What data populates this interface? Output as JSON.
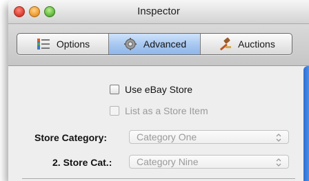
{
  "window": {
    "title": "Inspector"
  },
  "tabs": [
    {
      "label": "Options",
      "icon": "options-list-icon",
      "active": false
    },
    {
      "label": "Advanced",
      "icon": "gear-icon",
      "active": true
    },
    {
      "label": "Auctions",
      "icon": "gavel-icon",
      "active": false
    }
  ],
  "form": {
    "use_ebay_store": {
      "label": "Use eBay Store",
      "checked": false,
      "enabled": true
    },
    "list_as_store_item": {
      "label": "List as a Store Item",
      "checked": false,
      "enabled": false
    },
    "store_category": {
      "label": "Store Category:",
      "value": "Category One",
      "enabled": false
    },
    "store_category_2": {
      "label": "2. Store Cat.:",
      "value": "Category Nine",
      "enabled": false
    }
  },
  "colors": {
    "active_tab": "#a9c9f1",
    "scroll_accent": "#2d6fd1"
  }
}
